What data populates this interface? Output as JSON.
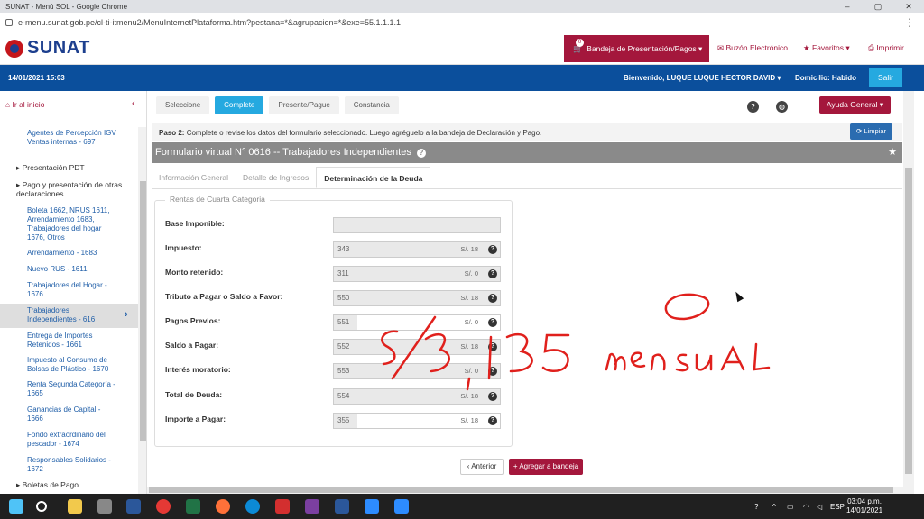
{
  "window": {
    "title": "SUNAT - Menú SOL - Google Chrome",
    "url": "e-menu.sunat.gob.pe/cl-ti-itmenu2/MenuInternetPlataforma.htm?pestana=*&agrupacion=*&exe=55.1.1.1.1"
  },
  "header": {
    "logo": "SUNAT",
    "bandeja_label": "Bandeja de Presentación/Pagos ▾",
    "bandeja_count": "0",
    "buzon_label": "Buzón Electrónico",
    "favoritos_label": "Favoritos ▾",
    "imprimir_label": "Imprimir"
  },
  "bluebar": {
    "datetime": "14/01/2021 15:03",
    "welcome": "Bienvenido, LUQUE LUQUE HECTOR DAVID ▾",
    "domicilio": "Domicilio: Habido",
    "salir": "Salir"
  },
  "sidebar": {
    "home": "Ir al inicio",
    "items": [
      "Agentes de Percepción IGV Ventas internas - 697",
      "Boleta 1662, NRUS 1611, Arrendamiento 1683, Trabajadores del hogar 1676, Otros",
      "Arrendamiento - 1683",
      "Nuevo RUS - 1611",
      "Trabajadores del Hogar - 1676",
      "Trabajadores Independientes - 616",
      "Entrega de Importes Retenidos - 1661",
      "Impuesto al Consumo de Bolsas de Plástico - 1670",
      "Renta Segunda Categoría - 1665",
      "Ganancias de Capital - 1666",
      "Fondo extraordinario del pescador - 1674",
      "Responsables Solidarios - 1672"
    ],
    "sections": [
      "▸ Presentación PDT",
      "▸ Pago y presentación de otras declaraciones",
      "▸ Boletas de Pago"
    ]
  },
  "steps": [
    "Seleccione",
    "Complete",
    "Presente/Pague",
    "Constancia"
  ],
  "ayuda": "Ayuda General ▾",
  "paso": {
    "strong": "Paso 2:",
    "text": " Complete o revise los datos del formulario seleccionado. Luego agréguelo a la bandeja de Declaración y Pago."
  },
  "limpiar": "Limpiar",
  "form_title": "Formulario virtual N° 0616 -- Trabajadores Independientes",
  "tabs": [
    "Información General",
    "Detalle de Ingresos",
    "Determinación de la Deuda"
  ],
  "legend": "Rentas de Cuarta Categoria",
  "fields": [
    {
      "label": "Base Imponible:",
      "code": "",
      "value": ""
    },
    {
      "label": "Impuesto:",
      "code": "343",
      "value": "S/. 18"
    },
    {
      "label": "Monto retenido:",
      "code": "311",
      "value": "S/. 0"
    },
    {
      "label": "Tributo a Pagar o Saldo a Favor:",
      "code": "550",
      "value": "S/. 18"
    },
    {
      "label": "Pagos Previos:",
      "code": "551",
      "value": "S/. 0"
    },
    {
      "label": "Saldo a Pagar:",
      "code": "552",
      "value": "S/. 18"
    },
    {
      "label": "Interés moratorio:",
      "code": "553",
      "value": "S/. 0"
    },
    {
      "label": "Total de Deuda:",
      "code": "554",
      "value": "S/. 18"
    },
    {
      "label": "Importe a Pagar:",
      "code": "355",
      "value": "S/. 18"
    }
  ],
  "buttons": {
    "anterior": "Anterior",
    "agregar": "Agregar a bandeja"
  },
  "annotation": {
    "amount": "S/3,135",
    "word": "mensual"
  },
  "taskbar": {
    "lang": "ESP",
    "time": "03:04 p.m.",
    "date": "14/01/2021"
  },
  "colors": {
    "brand_red": "#a4173c",
    "brand_blue": "#0b4f9c",
    "accent": "#25a9e0",
    "ink": "#e0201c"
  }
}
